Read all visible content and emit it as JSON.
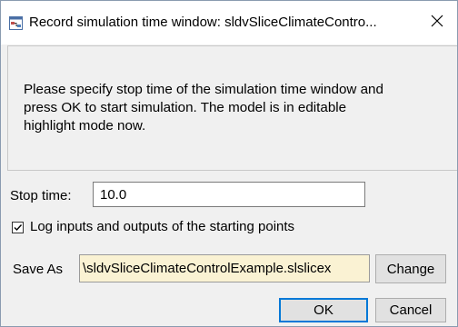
{
  "window": {
    "title": "Record simulation time window: sldvSliceClimateContro...",
    "app_icon": "simulink-model-icon",
    "close_icon": "close-icon"
  },
  "message": "Please specify stop time of the simulation time window and\npress OK to start simulation. The model is in editable\nhighlight mode now.",
  "stop_time": {
    "label": "Stop time:",
    "value": "10.0"
  },
  "log_option": {
    "label": "Log inputs and outputs of the starting points",
    "checked": true
  },
  "save_as": {
    "label": "Save As",
    "value": "\\sldvSliceClimateControlExample.slslicex",
    "change_label": "Change"
  },
  "buttons": {
    "ok_label": "OK",
    "cancel_label": "Cancel"
  },
  "colors": {
    "dialog_bg": "#f0f0f0",
    "title_bg": "#ffffff",
    "save_field_bg": "#faf2d3",
    "default_button_border": "#0078d7"
  }
}
